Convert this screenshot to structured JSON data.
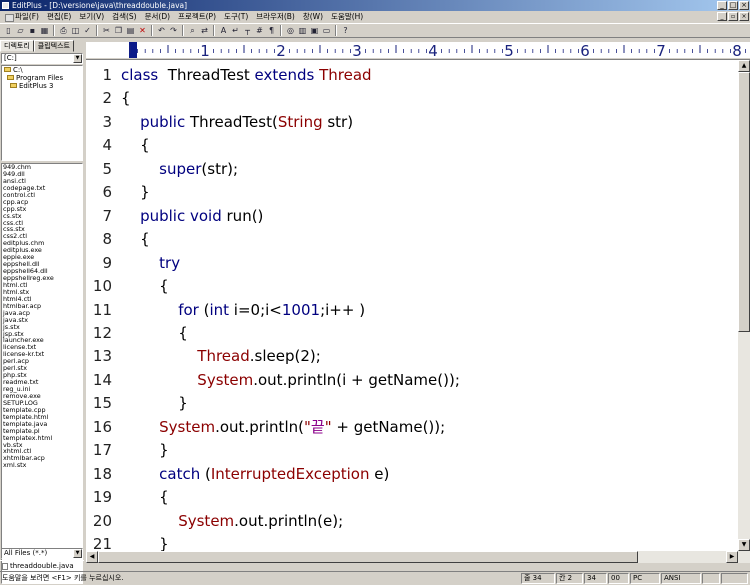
{
  "window": {
    "title": "EditPlus - [D:\\versione\\java\\threaddouble.java]"
  },
  "menu": [
    "파일(F)",
    "편집(E)",
    "보기(V)",
    "검색(S)",
    "문서(D)",
    "프로젝트(P)",
    "도구(T)",
    "브라우저(B)",
    "창(W)",
    "도움말(H)"
  ],
  "left_panel": {
    "tabs": [
      "디렉토리",
      "클립텍스트"
    ],
    "drive": "[C:]",
    "tree": [
      "C:\\",
      "Program Files",
      "EditPlus 3"
    ],
    "files": [
      "949.chm",
      "949.dll",
      "ansi.ctl",
      "codepage.txt",
      "control.ctl",
      "cpp.acp",
      "cpp.stx",
      "cs.stx",
      "css.ctl",
      "css.stx",
      "css2.ctl",
      "editplus.chm",
      "editplus.exe",
      "eppie.exe",
      "eppshell.dll",
      "eppshell64.dll",
      "eppshellreg.exe",
      "html.ctl",
      "html.stx",
      "html4.ctl",
      "htmlbar.acp",
      "java.acp",
      "java.stx",
      "js.stx",
      "jsp.stx",
      "launcher.exe",
      "license.txt",
      "license-kr.txt",
      "perl.acp",
      "perl.stx",
      "php.stx",
      "readme.txt",
      "reg_u.ini",
      "remove.exe",
      "SETUP.LOG",
      "template.cpp",
      "template.html",
      "template.java",
      "template.pl",
      "templatex.html",
      "vb.stx",
      "xhtml.ctl",
      "xhtmlbar.acp",
      "xml.stx"
    ],
    "filter": "All Files (*.*)",
    "open_file": "threaddouble.java"
  },
  "ruler": {
    "labels": [
      "1",
      "2",
      "3",
      "4",
      "5",
      "6",
      "7",
      "8"
    ]
  },
  "editor": {
    "lines": [
      {
        "n": "1",
        "t": [
          [
            "kw",
            "class"
          ],
          [
            "p",
            "  ThreadTest "
          ],
          [
            "kw",
            "extends"
          ],
          [
            "p",
            " "
          ],
          [
            "ty",
            "Thread"
          ]
        ]
      },
      {
        "n": "2",
        "t": [
          [
            "p",
            "{"
          ]
        ]
      },
      {
        "n": "3",
        "t": [
          [
            "p",
            "    "
          ],
          [
            "kw",
            "public"
          ],
          [
            "p",
            " ThreadTest("
          ],
          [
            "ty",
            "String"
          ],
          [
            "p",
            " str)"
          ]
        ]
      },
      {
        "n": "4",
        "t": [
          [
            "p",
            "    {"
          ]
        ]
      },
      {
        "n": "5",
        "t": [
          [
            "p",
            "        "
          ],
          [
            "kw",
            "super"
          ],
          [
            "p",
            "(str);"
          ]
        ]
      },
      {
        "n": "6",
        "t": [
          [
            "p",
            "    }"
          ]
        ]
      },
      {
        "n": "7",
        "t": [
          [
            "p",
            "    "
          ],
          [
            "kw",
            "public"
          ],
          [
            "p",
            " "
          ],
          [
            "kw",
            "void"
          ],
          [
            "p",
            " run()"
          ]
        ]
      },
      {
        "n": "8",
        "t": [
          [
            "p",
            "    {"
          ]
        ]
      },
      {
        "n": "9",
        "t": [
          [
            "p",
            "        "
          ],
          [
            "kw",
            "try"
          ]
        ]
      },
      {
        "n": "10",
        "t": [
          [
            "p",
            "        {"
          ]
        ]
      },
      {
        "n": "11",
        "t": [
          [
            "p",
            "            "
          ],
          [
            "kw",
            "for"
          ],
          [
            "p",
            " ("
          ],
          [
            "kw",
            "int"
          ],
          [
            "p",
            " i=0;i<"
          ],
          [
            "num",
            "1001"
          ],
          [
            "p",
            ";i++ )"
          ]
        ]
      },
      {
        "n": "12",
        "t": [
          [
            "p",
            "            {"
          ]
        ]
      },
      {
        "n": "13",
        "t": [
          [
            "p",
            "                "
          ],
          [
            "ty",
            "Thread"
          ],
          [
            "p",
            ".sleep(2);"
          ]
        ]
      },
      {
        "n": "14",
        "t": [
          [
            "p",
            "                "
          ],
          [
            "ty",
            "System"
          ],
          [
            "p",
            ".out.println(i + getName());"
          ]
        ]
      },
      {
        "n": "15",
        "t": [
          [
            "p",
            "            }"
          ]
        ]
      },
      {
        "n": "16",
        "t": [
          [
            "p",
            "        "
          ],
          [
            "ty",
            "System"
          ],
          [
            "p",
            ".out.println("
          ],
          [
            "str",
            "\""
          ],
          [
            "hangul",
            "끝"
          ],
          [
            "str",
            "\""
          ],
          [
            "p",
            " + getName());"
          ]
        ]
      },
      {
        "n": "17",
        "t": [
          [
            "p",
            "        }"
          ]
        ]
      },
      {
        "n": "18",
        "t": [
          [
            "p",
            "        "
          ],
          [
            "kw",
            "catch"
          ],
          [
            "p",
            " ("
          ],
          [
            "ty",
            "InterruptedException"
          ],
          [
            "p",
            " e)"
          ]
        ]
      },
      {
        "n": "19",
        "t": [
          [
            "p",
            "        {"
          ]
        ]
      },
      {
        "n": "20",
        "t": [
          [
            "p",
            "            "
          ],
          [
            "ty",
            "System"
          ],
          [
            "p",
            ".out.println(e);"
          ]
        ]
      },
      {
        "n": "21",
        "t": [
          [
            "p",
            "        }"
          ]
        ]
      }
    ]
  },
  "status": {
    "hint": "도움말을 보려면 <F1> 키를 누르십시오.",
    "line": "줄 34",
    "col": "칸 2",
    "total": "34",
    "sel": "00",
    "mode": "PC",
    "encoding": "ANSI"
  }
}
